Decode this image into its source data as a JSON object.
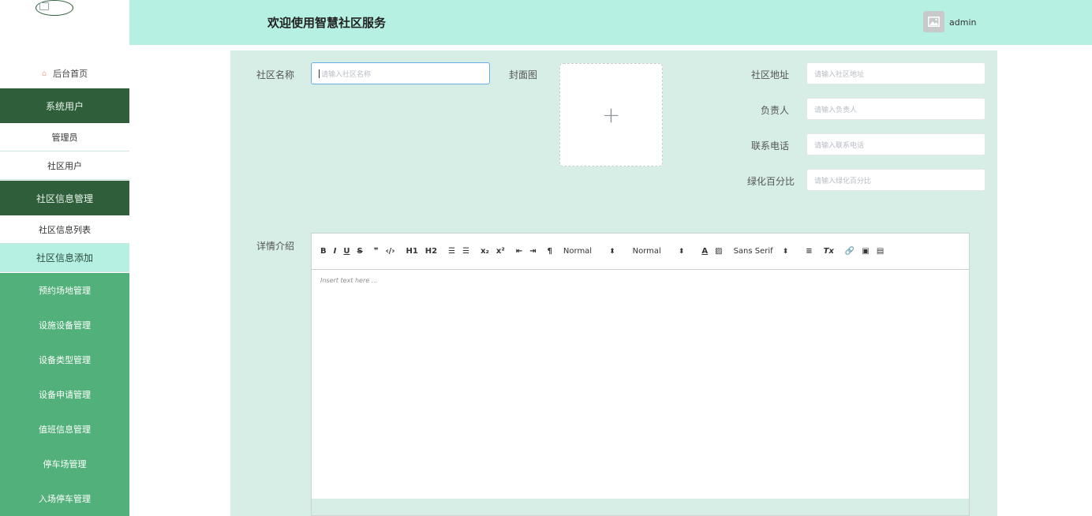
{
  "header": {
    "title": "欢迎使用智慧社区服务",
    "username": "admin"
  },
  "sidebar": {
    "home": "后台首页",
    "items": [
      {
        "label": "系统用户"
      },
      {
        "label": "管理员"
      },
      {
        "label": "社区用户"
      },
      {
        "label": "社区信息管理"
      },
      {
        "label": "社区信息列表"
      },
      {
        "label": "社区信息添加"
      },
      {
        "label": "预约场地管理"
      },
      {
        "label": "设施设备管理"
      },
      {
        "label": "设备类型管理"
      },
      {
        "label": "设备申请管理"
      },
      {
        "label": "值班信息管理"
      },
      {
        "label": "停车场管理"
      },
      {
        "label": "入场停车管理"
      }
    ]
  },
  "form": {
    "name_label": "社区名称",
    "name_placeholder": "请输入社区名称",
    "cover_label": "封面图",
    "upload_plus": "+",
    "address_label": "社区地址",
    "address_placeholder": "请输入社区地址",
    "manager_label": "负责人",
    "manager_placeholder": "请输入负责人",
    "phone_label": "联系电话",
    "phone_placeholder": "请输入联系电话",
    "green_label": "绿化百分比",
    "green_placeholder": "请输入绿化百分比",
    "detail_label": "详情介绍"
  },
  "editor": {
    "bold": "B",
    "italic": "I",
    "underline": "U",
    "strike": "S",
    "quote": "❞",
    "code": "‹/›",
    "h1": "H1",
    "h2": "H2",
    "ol": "☰",
    "ul": "☰",
    "sub": "x₂",
    "sup": "x²",
    "outdent": "⇤",
    "indent": "⇥",
    "dir": "¶",
    "size": "Normal",
    "header": "Normal",
    "color": "A",
    "bg": "▨",
    "font": "Sans Serif",
    "align": "≡",
    "clean": "Tx",
    "link": "🔗",
    "image": "▣",
    "video": "▤",
    "placeholder": "Insert text here ..."
  }
}
